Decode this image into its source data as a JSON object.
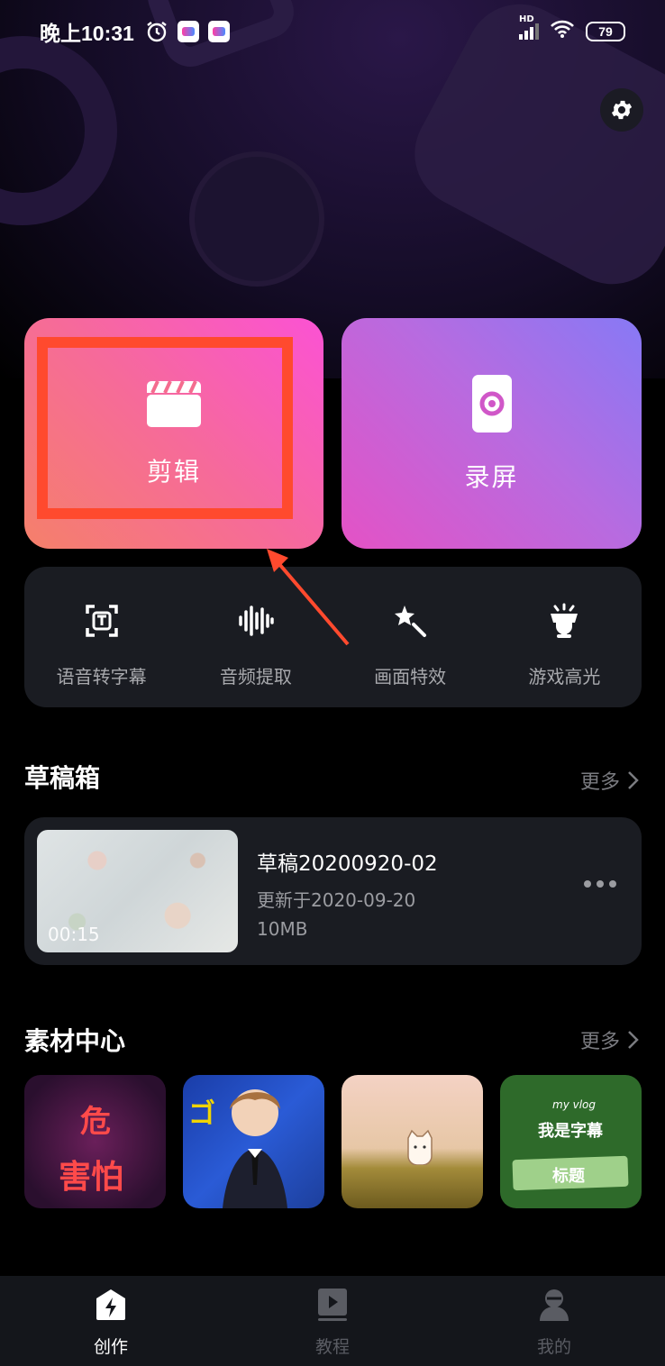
{
  "status_bar": {
    "time": "晚上10:31",
    "battery": "79",
    "network": "HD"
  },
  "main_cards": {
    "edit_label": "剪辑",
    "record_label": "录屏"
  },
  "tools": [
    {
      "label": "语音转字幕",
      "icon": "subtitle-icon"
    },
    {
      "label": "音频提取",
      "icon": "waveform-icon"
    },
    {
      "label": "画面特效",
      "icon": "magic-wand-icon"
    },
    {
      "label": "游戏高光",
      "icon": "trophy-icon"
    }
  ],
  "drafts": {
    "title": "草稿箱",
    "more": "更多",
    "item": {
      "name": "草稿20200920-02",
      "updated": "更新于2020-09-20",
      "size": "10MB",
      "duration": "00:15"
    }
  },
  "materials": {
    "title": "素材中心",
    "more": "更多",
    "items": [
      {
        "text_top": "危",
        "text_bottom": "害怕"
      },
      {
        "text": "ゴ"
      },
      {
        "text": ""
      },
      {
        "text_top": "my vlog",
        "text_mid": "我是字幕",
        "text_bottom": "标题"
      }
    ]
  },
  "bottom_nav": [
    {
      "label": "创作",
      "icon": "create-icon",
      "active": true
    },
    {
      "label": "教程",
      "icon": "tutorial-icon",
      "active": false
    },
    {
      "label": "我的",
      "icon": "profile-icon",
      "active": false
    }
  ],
  "colors": {
    "highlight": "#ff4a2e",
    "edit_card_start": "#f5806a",
    "edit_card_end": "#fb52d4",
    "record_card_start": "#e452c5",
    "record_card_end": "#8779f5",
    "panel": "#1a1c22"
  }
}
